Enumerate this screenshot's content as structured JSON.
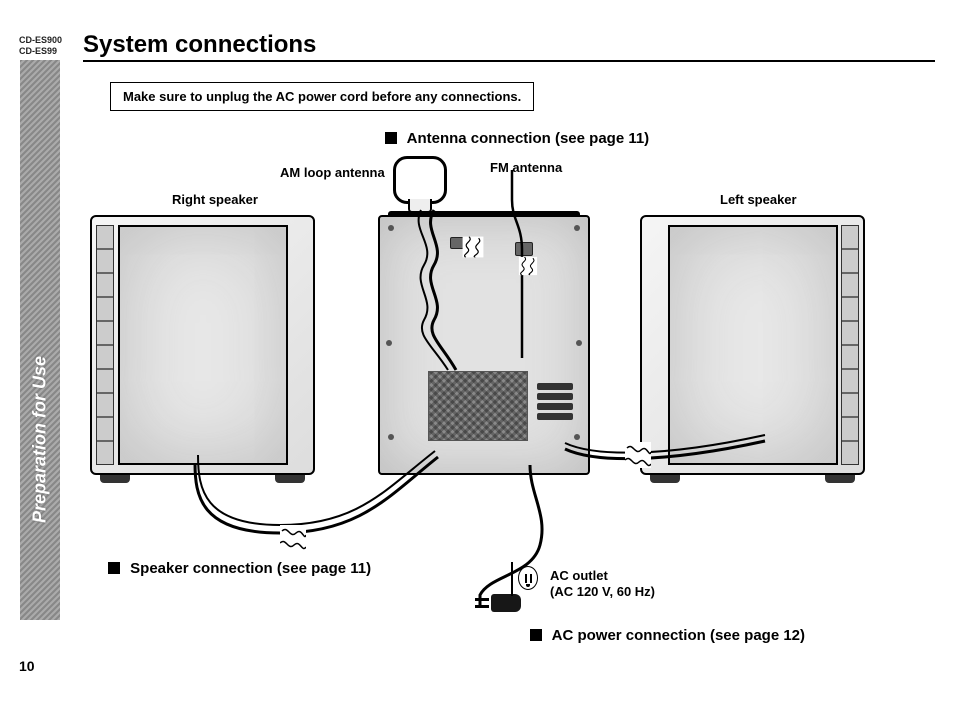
{
  "models": {
    "line1": "CD-ES900",
    "line2": "CD-ES99"
  },
  "title": "System connections",
  "sidebar": "Preparation for Use",
  "page_number": "10",
  "warning": "Make sure to unplug the AC power cord before any connections.",
  "headings": {
    "antenna": "Antenna connection (see page 11)",
    "speaker": "Speaker connection (see page 11)",
    "ac": "AC power connection (see page 12)"
  },
  "labels": {
    "am_loop": "AM loop antenna",
    "fm": "FM antenna",
    "right_speaker": "Right speaker",
    "left_speaker": "Left speaker",
    "ac_outlet_line1": "AC outlet",
    "ac_outlet_line2": "(AC 120 V, 60 Hz)"
  }
}
